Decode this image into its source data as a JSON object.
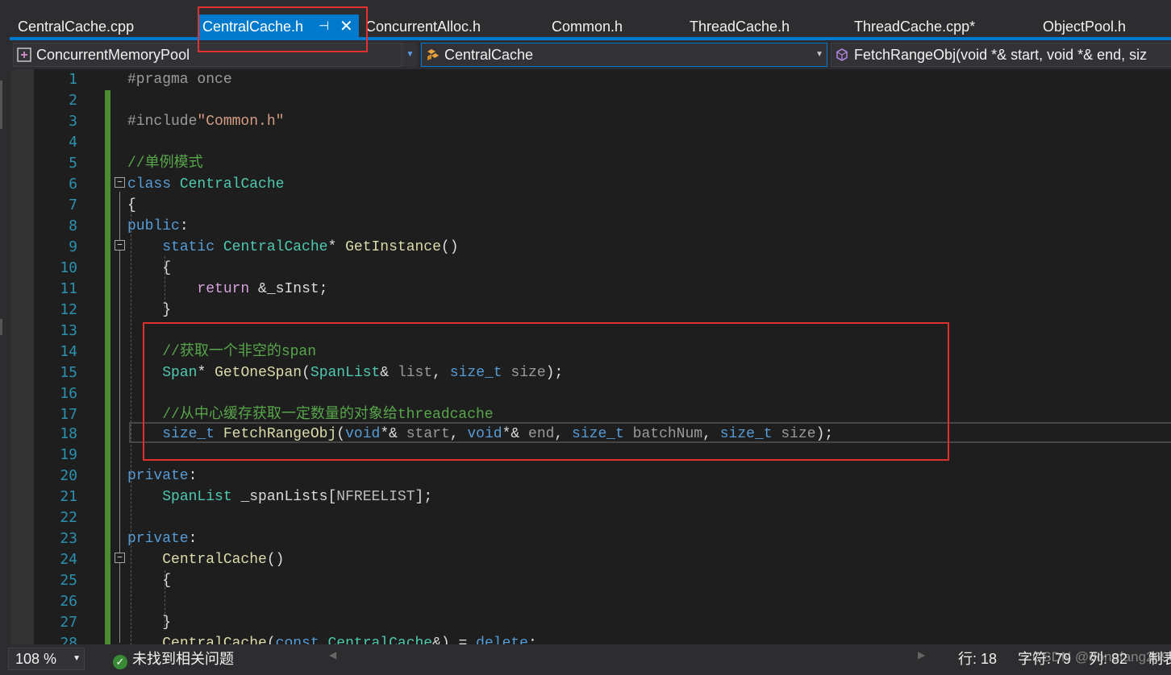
{
  "tabs": [
    {
      "label": "CentralCache.cpp",
      "active": false
    },
    {
      "label": "CentralCache.h",
      "active": true
    },
    {
      "label": "ConcurrentAlloc.h",
      "active": false
    },
    {
      "label": "Common.h",
      "active": false
    },
    {
      "label": "ThreadCache.h",
      "active": false
    },
    {
      "label": "ThreadCache.cpp*",
      "active": false
    },
    {
      "label": "ObjectPool.h",
      "active": false
    }
  ],
  "active_tab_icons": {
    "pin": "pin-icon",
    "close": "close-icon"
  },
  "navbar": {
    "project": "ConcurrentMemoryPool",
    "scope": "CentralCache",
    "member": "FetchRangeObj(void *& start, void *& end, siz"
  },
  "code_lines": [
    {
      "n": "1",
      "t": "#pragma once"
    },
    {
      "n": "2",
      "t": ""
    },
    {
      "n": "3",
      "t": "#include\"Common.h\""
    },
    {
      "n": "4",
      "t": ""
    },
    {
      "n": "5",
      "t": "//单例模式"
    },
    {
      "n": "6",
      "t": "class CentralCache"
    },
    {
      "n": "7",
      "t": "{"
    },
    {
      "n": "8",
      "t": "public:"
    },
    {
      "n": "9",
      "t": "static CentralCache* GetInstance()"
    },
    {
      "n": "10",
      "t": "{"
    },
    {
      "n": "11",
      "t": "return &_sInst;"
    },
    {
      "n": "12",
      "t": "}"
    },
    {
      "n": "13",
      "t": ""
    },
    {
      "n": "14",
      "t": "//获取一个非空的span"
    },
    {
      "n": "15",
      "t": "Span* GetOneSpan(SpanList& list, size_t size);"
    },
    {
      "n": "16",
      "t": ""
    },
    {
      "n": "17",
      "t": "//从中心缓存获取一定数量的对象给threadcache"
    },
    {
      "n": "18",
      "t": "size_t FetchRangeObj(void*& start, void*& end, size_t batchNum, size_t size);"
    },
    {
      "n": "19",
      "t": ""
    },
    {
      "n": "20",
      "t": "private:"
    },
    {
      "n": "21",
      "t": "SpanList _spanLists[NFREELIST];"
    },
    {
      "n": "22",
      "t": ""
    },
    {
      "n": "23",
      "t": "private:"
    },
    {
      "n": "24",
      "t": "CentralCache()"
    },
    {
      "n": "25",
      "t": "{"
    },
    {
      "n": "26",
      "t": ""
    },
    {
      "n": "27",
      "t": "}"
    },
    {
      "n": "28",
      "t": "CentralCache(const CentralCache&) = delete;"
    }
  ],
  "tokens": {
    "pragma_once": "#pragma once",
    "include": "#include",
    "include_file": "\"Common.h\"",
    "comment_singleton": "//单例模式",
    "class_kw": "class",
    "class_name": "CentralCache",
    "brace_open": "{",
    "brace_close": "}",
    "public_kw": "public",
    "colon": ":",
    "static_kw": "static",
    "star": "*",
    "get_instance": "GetInstance",
    "paren_pair": "()",
    "return_kw": "return",
    "amp": "&",
    "sinst": "_sInst",
    "semicolon": ";",
    "comment_getonespan": "//获取一个非空的span",
    "span_type": "Span",
    "get_one_span": "GetOneSpan",
    "paren_open": "(",
    "paren_close": ")",
    "spanlist_type": "SpanList",
    "list_param": "list",
    "comma": ",",
    "size_t": "size_t",
    "size_param": "size",
    "comment_fetch": "//从中心缓存获取一定数量的对象给threadcache",
    "fetch_range_obj": "FetchRangeObj",
    "void_kw": "void",
    "ptr_ref": "*&",
    "start_param": "start",
    "end_param": "end",
    "batchnum_param": "batchNum",
    "private_kw": "private",
    "span_lists": "_spanLists",
    "bracket_open": "[",
    "bracket_close": "]",
    "nfreelist": "NFREELIST",
    "const_kw": "const",
    "eq": "=",
    "delete_kw": "delete"
  },
  "statusbar": {
    "zoom": "108 %",
    "issues": "未找到相关问题",
    "line": "行: 18",
    "char": "字符: 79",
    "col": "列: 82",
    "tabs": "制表"
  },
  "watermark": "CSDN @dongfang2693",
  "colors": {
    "accent": "#007acc",
    "annotation": "#e03030",
    "change_bar": "#4d8c2e",
    "keyword": "#569cd6",
    "type": "#4ec9b0",
    "function": "#dcdcaa",
    "comment": "#57a64a",
    "control_keyword": "#d8a0df",
    "line_number": "#2b91af"
  }
}
